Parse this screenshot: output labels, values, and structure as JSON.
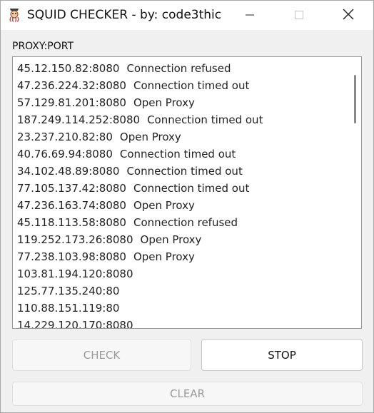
{
  "window": {
    "title": "SQUID CHECKER - by: code3thic"
  },
  "titlebar_controls": {
    "minimize_icon": "minimize-icon",
    "maximize_icon": "maximize-icon",
    "close_icon": "close-icon"
  },
  "proxy_label": "PROXY:PORT",
  "proxy_list": [
    {
      "ip": "45.12.150.82:8080",
      "status": "Connection refused"
    },
    {
      "ip": "47.236.224.32:8080",
      "status": "Connection timed out"
    },
    {
      "ip": "57.129.81.201:8080",
      "status": "Open Proxy"
    },
    {
      "ip": "187.249.114.252:8080",
      "status": "Connection timed out"
    },
    {
      "ip": "23.237.210.82:80",
      "status": "Open Proxy"
    },
    {
      "ip": "40.76.69.94:8080",
      "status": "Connection timed out"
    },
    {
      "ip": "34.102.48.89:8080",
      "status": "Connection timed out"
    },
    {
      "ip": "77.105.137.42:8080",
      "status": "Connection timed out"
    },
    {
      "ip": "47.236.163.74:8080",
      "status": "Open Proxy"
    },
    {
      "ip": "45.118.113.58:8080",
      "status": "Connection refused"
    },
    {
      "ip": "119.252.173.26:8080",
      "status": "Open Proxy"
    },
    {
      "ip": "77.238.103.98:8080",
      "status": "Open Proxy"
    },
    {
      "ip": "103.81.194.120:8080",
      "status": ""
    },
    {
      "ip": "125.77.135.240:80",
      "status": ""
    },
    {
      "ip": "110.88.151.119:80",
      "status": ""
    },
    {
      "ip": "14.229.120.170:8080",
      "status": ""
    }
  ],
  "buttons": {
    "check_label": "CHECK",
    "stop_label": "STOP",
    "clear_label": "CLEAR"
  },
  "colors": {
    "window_bg": "#f0f0f0",
    "list_bg": "#ffffff",
    "disabled_text": "#9a9a9a",
    "text": "#222222"
  }
}
